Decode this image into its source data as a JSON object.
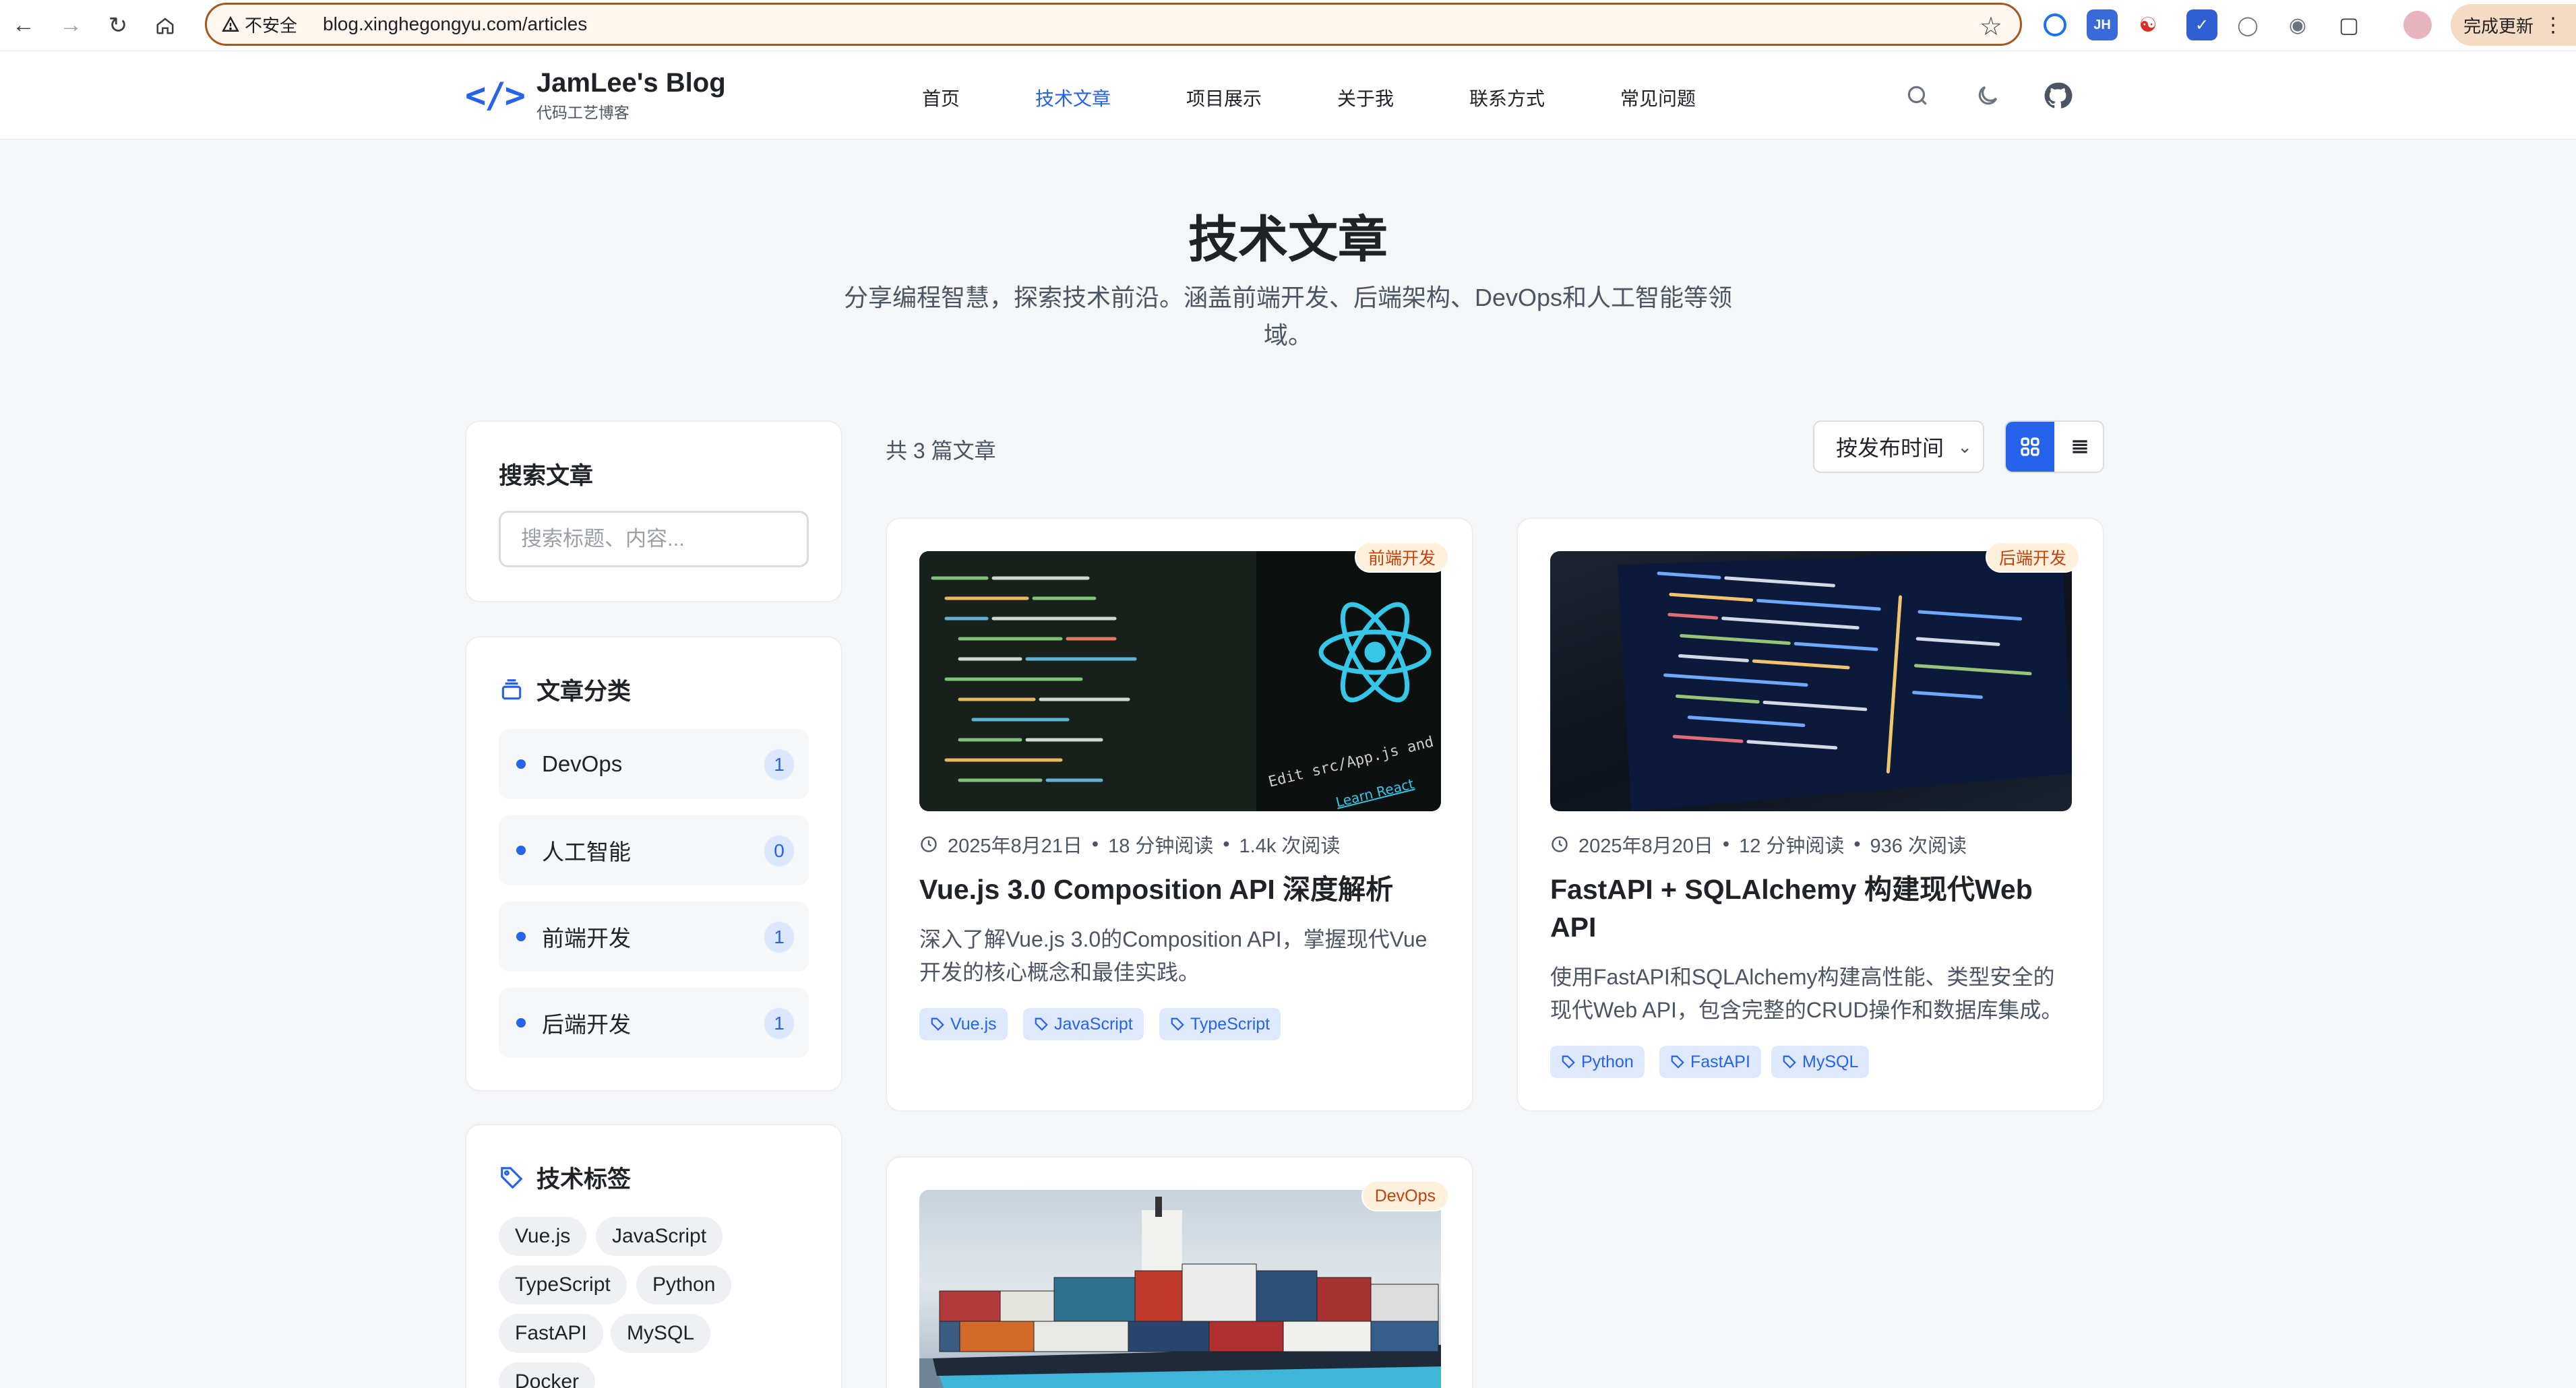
{
  "browser": {
    "security_label": "不安全",
    "url": "blog.xinghegongyu.com/articles",
    "update_button": "完成更新",
    "extensions": [
      "JH"
    ]
  },
  "site": {
    "logo_icon": "</>",
    "logo_title": "JamLee's Blog",
    "logo_subtitle": "代码工艺博客",
    "nav": [
      "首页",
      "技术文章",
      "项目展示",
      "关于我",
      "联系方式",
      "常见问题"
    ],
    "active_nav": "技术文章",
    "icons": [
      "search-icon",
      "moon-icon",
      "github-icon"
    ]
  },
  "hero": {
    "title": "技术文章",
    "subtitle": "分享编程智慧，探索技术前沿。涵盖前端开发、后端架构、DevOps和人工智能等领域。"
  },
  "sidebar": {
    "search_title": "搜索文章",
    "search_placeholder": "搜索标题、内容...",
    "categories_title": "文章分类",
    "categories": [
      {
        "name": "DevOps",
        "count": "1"
      },
      {
        "name": "人工智能",
        "count": "0"
      },
      {
        "name": "前端开发",
        "count": "1"
      },
      {
        "name": "后端开发",
        "count": "1"
      }
    ],
    "tags_title": "技术标签",
    "tags": [
      "Vue.js",
      "JavaScript",
      "TypeScript",
      "Python",
      "FastAPI",
      "MySQL",
      "Docker"
    ]
  },
  "toolbar": {
    "count_text": "共 3 篇文章",
    "sort_value": "按发布时间",
    "view_modes": [
      "grid-view-icon",
      "list-view-icon"
    ]
  },
  "articles": [
    {
      "category": "前端开发",
      "date": "2025年8月21日",
      "read_time": "18 分钟阅读",
      "views": "1.4k 次阅读",
      "title": "Vue.js 3.0 Composition API 深度解析",
      "excerpt": "深入了解Vue.js 3.0的Composition API，掌握现代Vue开发的核心概念和最佳实践。",
      "tags": [
        "Vue.js",
        "JavaScript",
        "TypeScript"
      ],
      "image": "react-code-photo",
      "image_caption": "Edit src/App.js and save to reload.",
      "image_link": "Learn React"
    },
    {
      "category": "后端开发",
      "date": "2025年8月20日",
      "read_time": "12 分钟阅读",
      "views": "936 次阅读",
      "title": "FastAPI + SQLAlchemy 构建现代Web API",
      "excerpt": "使用FastAPI和SQLAlchemy构建高性能、类型安全的现代Web API，包含完整的CRUD操作和数据库集成。",
      "tags": [
        "Python",
        "FastAPI",
        "MySQL"
      ],
      "image": "laptop-code-photo"
    },
    {
      "category": "DevOps",
      "image": "container-ship-photo"
    }
  ]
}
